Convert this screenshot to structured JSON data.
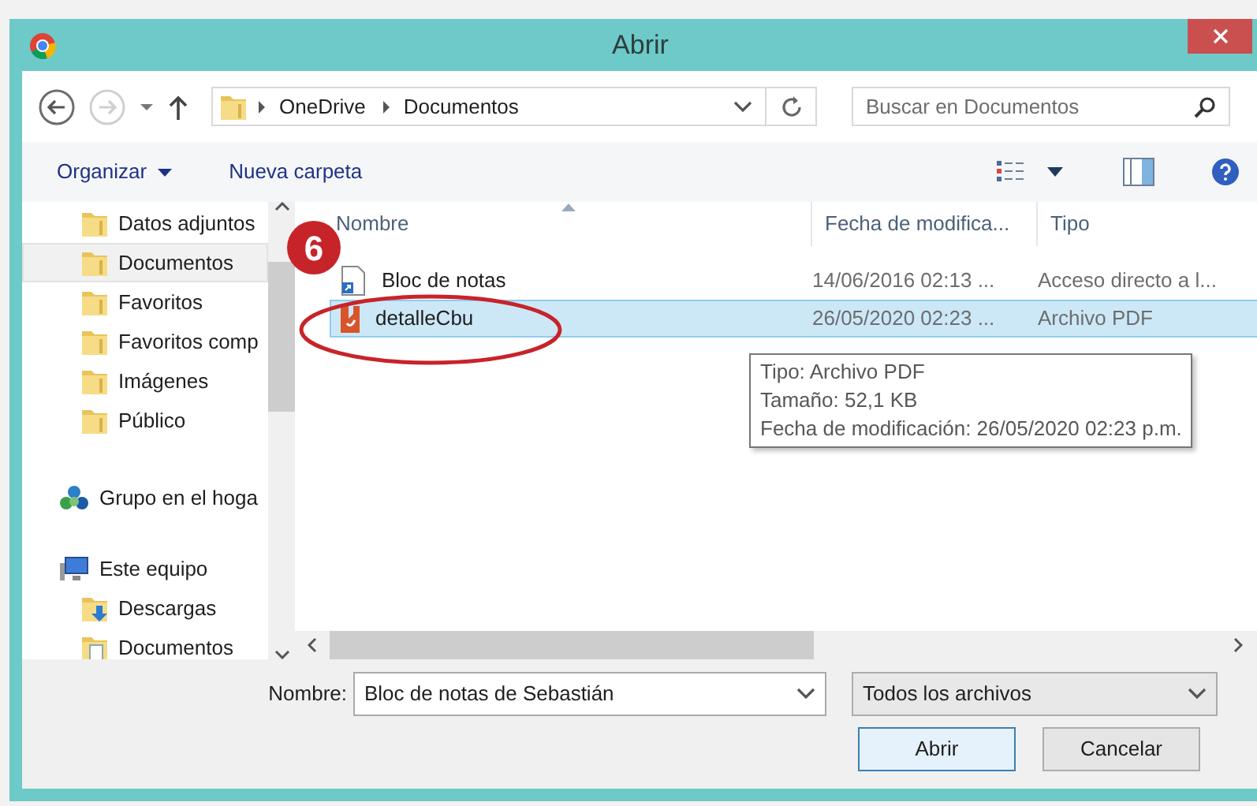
{
  "window": {
    "title": "Abrir"
  },
  "nav": {
    "path": [
      "OneDrive",
      "Documentos"
    ],
    "search_placeholder": "Buscar en Documentos"
  },
  "commands": [
    {
      "label": "Organizar",
      "dropdown": true
    },
    {
      "label": "Nueva carpeta",
      "dropdown": false
    }
  ],
  "sidebar": {
    "items": [
      {
        "children": [
          {
            "label": "Datos adjuntos",
            "kind": "folder",
            "selected": false
          },
          {
            "label": "Documentos",
            "kind": "folder",
            "selected": true
          },
          {
            "label": "Favoritos",
            "kind": "folder",
            "selected": false
          },
          {
            "label": "Favoritos comp",
            "kind": "folder",
            "selected": false
          },
          {
            "label": "Imágenes",
            "kind": "folder",
            "selected": false
          },
          {
            "label": "Público",
            "kind": "folder",
            "selected": false
          }
        ]
      },
      {
        "label": "Grupo en el hoga",
        "kind": "homegroup",
        "selected": false
      },
      {
        "label": "Este equipo",
        "kind": "computer",
        "selected": false,
        "children": [
          {
            "label": "Descargas",
            "kind": "downloads",
            "selected": false
          },
          {
            "label": "Documentos",
            "kind": "documents",
            "selected": false
          }
        ]
      }
    ]
  },
  "table": {
    "columns": [
      "Nombre",
      "Fecha de modifica...",
      "Tipo"
    ],
    "rows": [
      {
        "name": "Bloc de notas",
        "date": "14/06/2016 02:13 ...",
        "type": "Acceso directo a l...",
        "kind": "shortcut",
        "selected": false
      },
      {
        "name": "detalleCbu",
        "date": "26/05/2020 02:23 ...",
        "type": "Archivo PDF",
        "kind": "pdf",
        "selected": true
      }
    ]
  },
  "tooltip": [
    "Tipo: Archivo PDF",
    "Tamaño: 52,1 KB",
    "Fecha de modificación: 26/05/2020 02:23 p.m."
  ],
  "footer": {
    "name_label": "Nombre:",
    "name_value": "Bloc de notas de Sebastián",
    "filter": "Todos los archivos",
    "buttons": [
      "Abrir",
      "Cancelar"
    ]
  },
  "annotations": [
    {
      "kind": "badge",
      "text": "6"
    },
    {
      "kind": "ellipse"
    }
  ]
}
